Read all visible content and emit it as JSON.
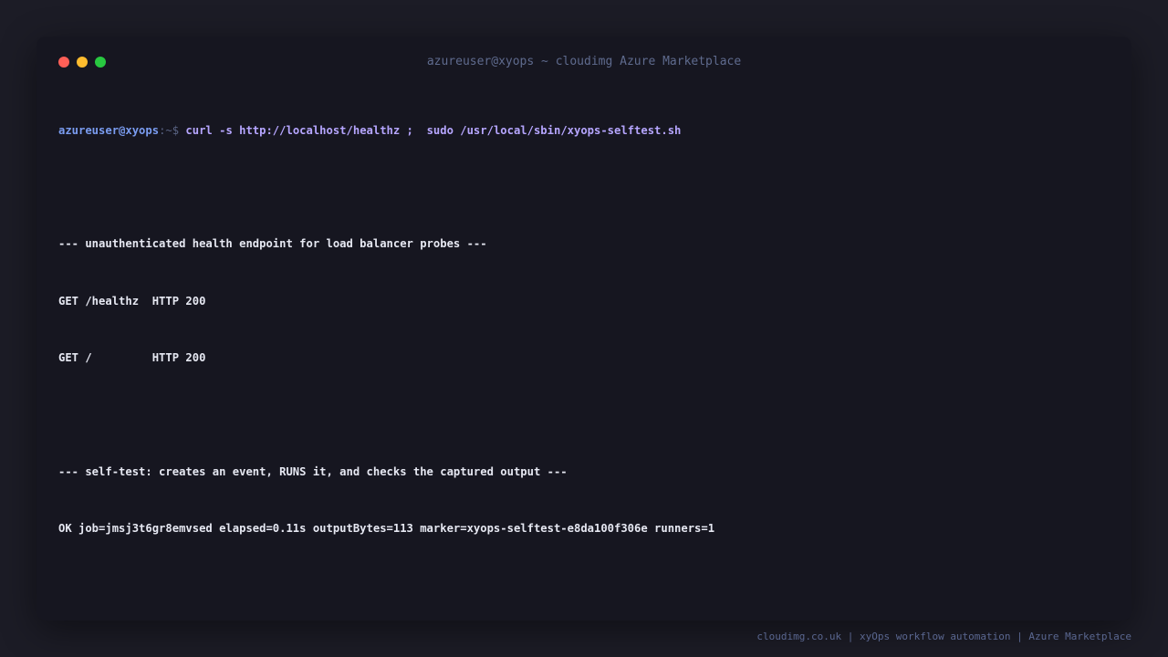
{
  "window": {
    "title": "azureuser@xyops ~ cloudimg Azure Marketplace"
  },
  "prompt": {
    "user_host": "azureuser@xyops",
    "path_symbol": ":~$ ",
    "command": "curl -s http://localhost/healthz ;  sudo /usr/local/sbin/xyops-selftest.sh"
  },
  "output": {
    "health_header": "--- unauthenticated health endpoint for load balancer probes ---",
    "health_line_1": "GET /healthz  HTTP 200",
    "health_line_2": "GET /         HTTP 200",
    "selftest_header": "--- self-test: creates an event, RUNS it, and checks the captured output ---",
    "selftest_result": "OK job=jmsj3t6gr8emvsed elapsed=0.11s outputBytes=113 marker=xyops-selftest-e8da100f306e runners=1"
  },
  "footer": {
    "text": "cloudimg.co.uk | xyOps workflow automation | Azure Marketplace"
  },
  "colors": {
    "window_close": "#ff5f57",
    "window_minimize": "#febc2e",
    "window_maximize": "#28c840",
    "prompt_user": "#7a9cf0",
    "command": "#b6a6ff"
  }
}
